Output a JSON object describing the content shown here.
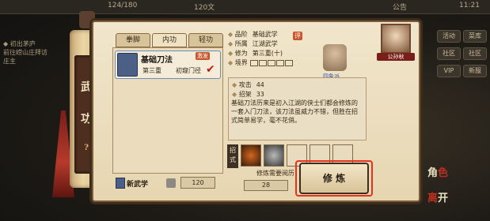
{
  "topbar": {
    "stat_a": "124/180",
    "stat_b": "120文",
    "right_label": "公告",
    "time": "11:21"
  },
  "left_quest": {
    "title": "◆ 初出茅庐",
    "line1": "前往崂山庄拜访",
    "line2": "庄主"
  },
  "scroll_label": {
    "char1": "武",
    "char2": "功",
    "glyph": "?"
  },
  "tabs": [
    {
      "label": "拳脚"
    },
    {
      "label": "内功"
    },
    {
      "label": "轻功"
    }
  ],
  "skill": {
    "name": "基础刀法",
    "badge": "激发",
    "volume": "第三重",
    "grade": "初窥门径",
    "check": "✔"
  },
  "bottom": {
    "new_learn": "新武学",
    "points": "120"
  },
  "attributes": {
    "grade_label": "品阶",
    "grade_value": "基础武学",
    "grade_badge": "评",
    "school_label": "所属",
    "school_value": "江湖武学",
    "train_label": "修为",
    "train_value": "第三重(十)",
    "realm_label": "境界"
  },
  "character": {
    "portrait_name": "公孙秋",
    "school_mark": "四象派"
  },
  "stats": {
    "attack_label": "攻击",
    "attack_value": "44",
    "parry_label": "招架",
    "parry_value": "33"
  },
  "description": "基础刀法历来是初入江湖的侠士们都会修炼的一套入门刀法，该刀法虽威力不错，但胜在招式简单易学，毫不花俏。",
  "moves": {
    "label": "招式"
  },
  "training": {
    "requirement": "修炼需要阅历",
    "value": "28",
    "button": "修 炼"
  },
  "right_buttons": [
    "活动",
    "菜库",
    "社区",
    "社区",
    "VIP",
    "新服"
  ],
  "right_side": {
    "char_a": "角",
    "char_b": "色",
    "char_c": "离",
    "char_d": "开"
  },
  "colors": {
    "highlight_frame": "#e8321e",
    "accent_red": "#7a1e1a"
  }
}
